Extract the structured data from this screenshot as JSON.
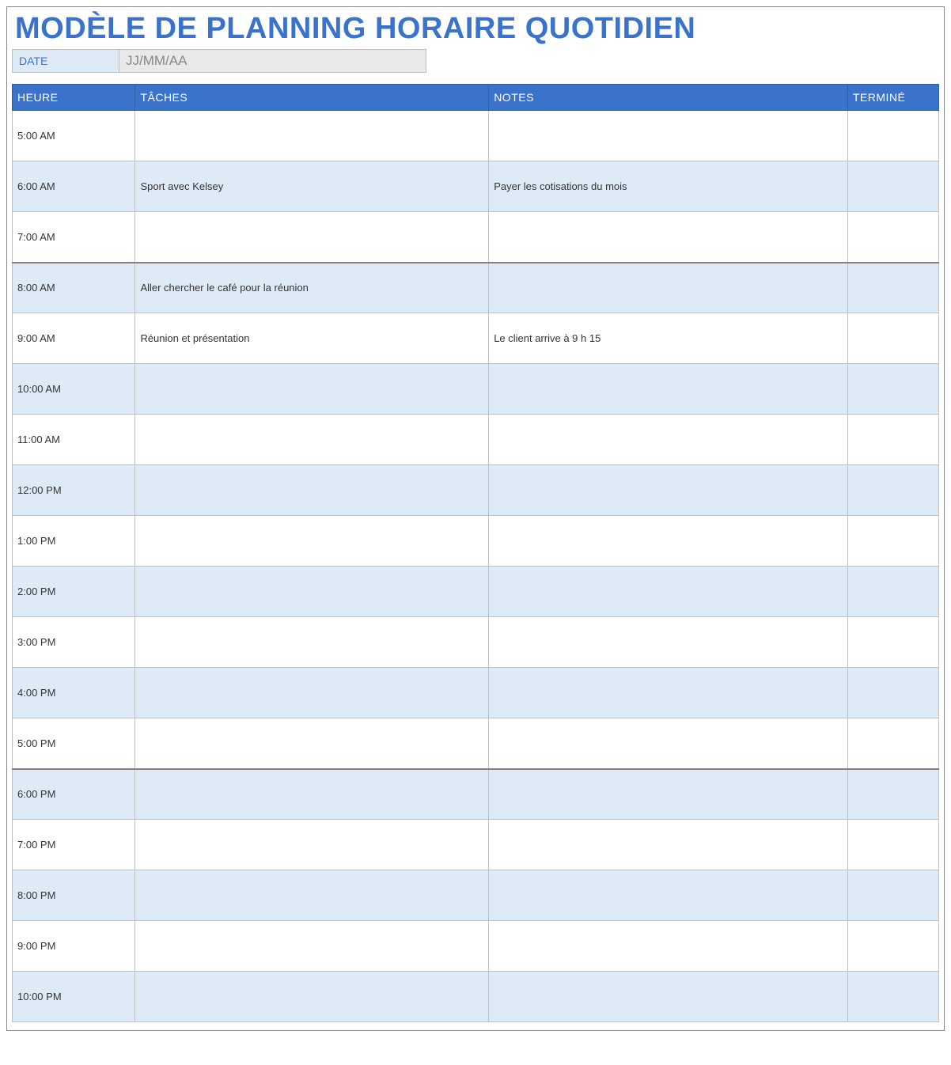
{
  "title": "MODÈLE DE PLANNING HORAIRE QUOTIDIEN",
  "date": {
    "label": "DATE",
    "value": "JJ/MM/AA"
  },
  "columns": {
    "time": "HEURE",
    "tasks": "TÂCHES",
    "notes": "NOTES",
    "done": "TERMINÉ"
  },
  "rows": [
    {
      "time": "5:00 AM",
      "task": "",
      "note": "",
      "done": "",
      "shade": "odd",
      "divider": false
    },
    {
      "time": "6:00 AM",
      "task": "Sport avec Kelsey",
      "note": "Payer les cotisations du mois",
      "done": "",
      "shade": "even",
      "divider": false
    },
    {
      "time": "7:00 AM",
      "task": "",
      "note": "",
      "done": "",
      "shade": "odd",
      "divider": false
    },
    {
      "time": "8:00 AM",
      "task": "Aller chercher le café pour la réunion",
      "note": "",
      "done": "",
      "shade": "even",
      "divider": true
    },
    {
      "time": "9:00 AM",
      "task": "Réunion et présentation",
      "note": "Le client arrive à 9 h 15",
      "done": "",
      "shade": "odd",
      "divider": false
    },
    {
      "time": "10:00 AM",
      "task": "",
      "note": "",
      "done": "",
      "shade": "even",
      "divider": false
    },
    {
      "time": "11:00 AM",
      "task": "",
      "note": "",
      "done": "",
      "shade": "odd",
      "divider": false
    },
    {
      "time": "12:00 PM",
      "task": "",
      "note": "",
      "done": "",
      "shade": "even",
      "divider": false
    },
    {
      "time": "1:00 PM",
      "task": "",
      "note": "",
      "done": "",
      "shade": "odd",
      "divider": false
    },
    {
      "time": "2:00 PM",
      "task": "",
      "note": "",
      "done": "",
      "shade": "even",
      "divider": false
    },
    {
      "time": "3:00 PM",
      "task": "",
      "note": "",
      "done": "",
      "shade": "odd",
      "divider": false
    },
    {
      "time": "4:00 PM",
      "task": "",
      "note": "",
      "done": "",
      "shade": "even",
      "divider": false
    },
    {
      "time": "5:00 PM",
      "task": "",
      "note": "",
      "done": "",
      "shade": "odd",
      "divider": false
    },
    {
      "time": "6:00 PM",
      "task": "",
      "note": "",
      "done": "",
      "shade": "even",
      "divider": true
    },
    {
      "time": "7:00 PM",
      "task": "",
      "note": "",
      "done": "",
      "shade": "odd",
      "divider": false
    },
    {
      "time": "8:00 PM",
      "task": "",
      "note": "",
      "done": "",
      "shade": "even",
      "divider": false
    },
    {
      "time": "9:00 PM",
      "task": "",
      "note": "",
      "done": "",
      "shade": "odd",
      "divider": false
    },
    {
      "time": "10:00 PM",
      "task": "",
      "note": "",
      "done": "",
      "shade": "even",
      "divider": false
    }
  ]
}
